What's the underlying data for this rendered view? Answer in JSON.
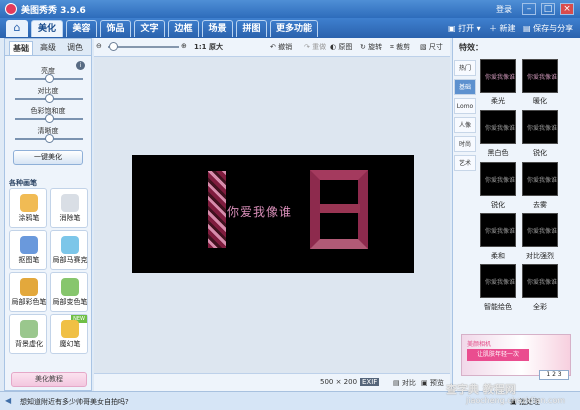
{
  "title": {
    "app": "美图秀秀 3.9.6",
    "login": "登录"
  },
  "nav": {
    "tabs": [
      "美化",
      "美容",
      "饰品",
      "文字",
      "边框",
      "场景",
      "拼图",
      "更多功能"
    ],
    "actions": [
      "打开",
      "新建",
      "保存与分享"
    ]
  },
  "left": {
    "subtabs": [
      "基础",
      "高级",
      "调色"
    ],
    "sliders": [
      "亮度",
      "对比度",
      "色彩饱和度",
      "清晰度"
    ],
    "auto_button": "一键美化",
    "brushes_heading": "各种画笔",
    "tools": [
      "涂鸦笔",
      "消除笔",
      "抠图笔",
      "局部马赛克",
      "局部彩色笔",
      "局部变色笔",
      "背景虚化",
      "魔幻笔"
    ],
    "new_badge": "NEW",
    "tutorial_button": "美化教程"
  },
  "toolbar": {
    "zoom_label": "原大",
    "undo": "撤销",
    "redo": "重做",
    "original": "原图",
    "rotate": "旋转",
    "crop": "裁剪",
    "size": "尺寸"
  },
  "canvas": {
    "caption": "你爱我像谁"
  },
  "status": {
    "dimensions": "500 × 200",
    "exif": "EXIF",
    "compare": "对比",
    "preview": "预览"
  },
  "right": {
    "title": "特效：",
    "categories": [
      "热门",
      "基础",
      "Lomo",
      "人像",
      "时尚",
      "艺术"
    ],
    "effects": [
      "柔光",
      "暖化",
      "黑白色",
      "锐化",
      "去雾",
      "柔和",
      "对比强烈",
      "智能绘色",
      "全彩"
    ],
    "effect_thumb_text": "你爱我像谁",
    "ad": {
      "logo": "美颜相机",
      "main": "让肌肤年轻一次"
    },
    "pager": "1 2 3"
  },
  "bottom": {
    "message": "想知道附近有多少帅哥美女自拍吗?",
    "batch": "批处理",
    "watermark": "查字典 教程网",
    "watermark_sub": "jiaocheng.chazidian.com"
  }
}
